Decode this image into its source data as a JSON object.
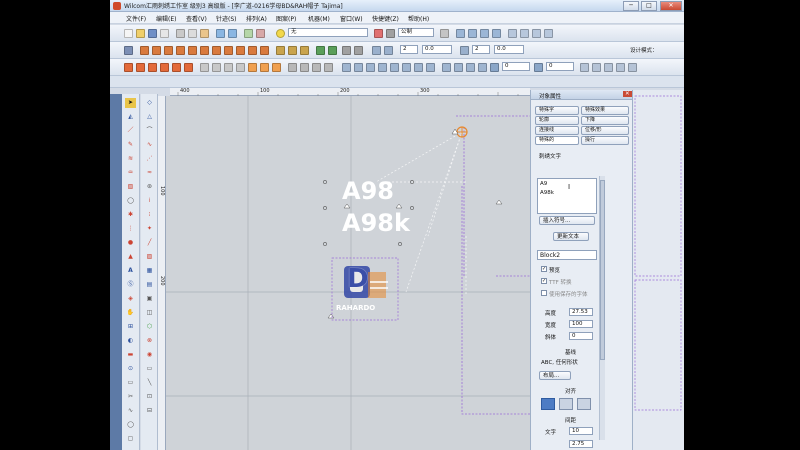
{
  "titlebar": {
    "title": "Wilcom汇雨刺绣工作室  级别3 高级版 - [李广道-0216学母BD&RAH帽子            Tajima]",
    "minimize": "─",
    "maximize": "□",
    "close": "✕"
  },
  "menubar": {
    "items": [
      "文件(F)",
      "编辑(E)",
      "查看(V)",
      "针迹(S)",
      "排列(A)",
      "图案(P)",
      "机器(M)",
      "窗口(W)",
      "快捷键(Z)",
      "帮助(H)"
    ]
  },
  "toolbar": {
    "color_label": "无",
    "units_label": "公制",
    "value_2a": "2",
    "value_0a": "0.0",
    "value_2b": "2",
    "value_0b": "0.0",
    "design_mode": "设计模式：",
    "rotate_value": "0",
    "spin_value": "0"
  },
  "ruler": {
    "top_ticks": [
      "400",
      "100",
      "200",
      "300"
    ],
    "left_ticks": [
      "100",
      "200"
    ]
  },
  "canvas": {
    "text_line1": "A98",
    "text_line2": "A98k",
    "logo_letter": "D",
    "logo_word": "RAHARDO"
  },
  "panel": {
    "title": "对象属性",
    "tabs": [
      "特殊字",
      "特殊效果",
      "轮廓",
      "下降",
      "连接线",
      "位移/形",
      "特殊的",
      "操行"
    ],
    "section_label": "刺绣文字",
    "text_content_line1": "A9",
    "text_content_line2": "A98k",
    "insert_symbol": "插入符号...",
    "update_text": "更新文本",
    "font_name": "Block2",
    "chk_preview": "预览",
    "chk_ttf": "TTF 转换",
    "chk_save_font": "使用保存的字体",
    "height_label": "高度",
    "height_value": "27.53",
    "width_label": "宽度",
    "width_value": "100",
    "slant_label": "斜体",
    "slant_value": "0",
    "baseline_label": "基线",
    "baseline_value": "ABC, 任何形状",
    "layout_btn": "布局...",
    "align_label": "对齐",
    "spacing_label": "间距",
    "letter_label": "文字",
    "letter_value": "10",
    "line_value": "2.75"
  },
  "colors": {
    "canvas_bg": "#cfd3d8",
    "selection_violet": "#9a6cd6",
    "logo_blue": "#3b4fa8",
    "accent_orange": "#e8892e"
  }
}
